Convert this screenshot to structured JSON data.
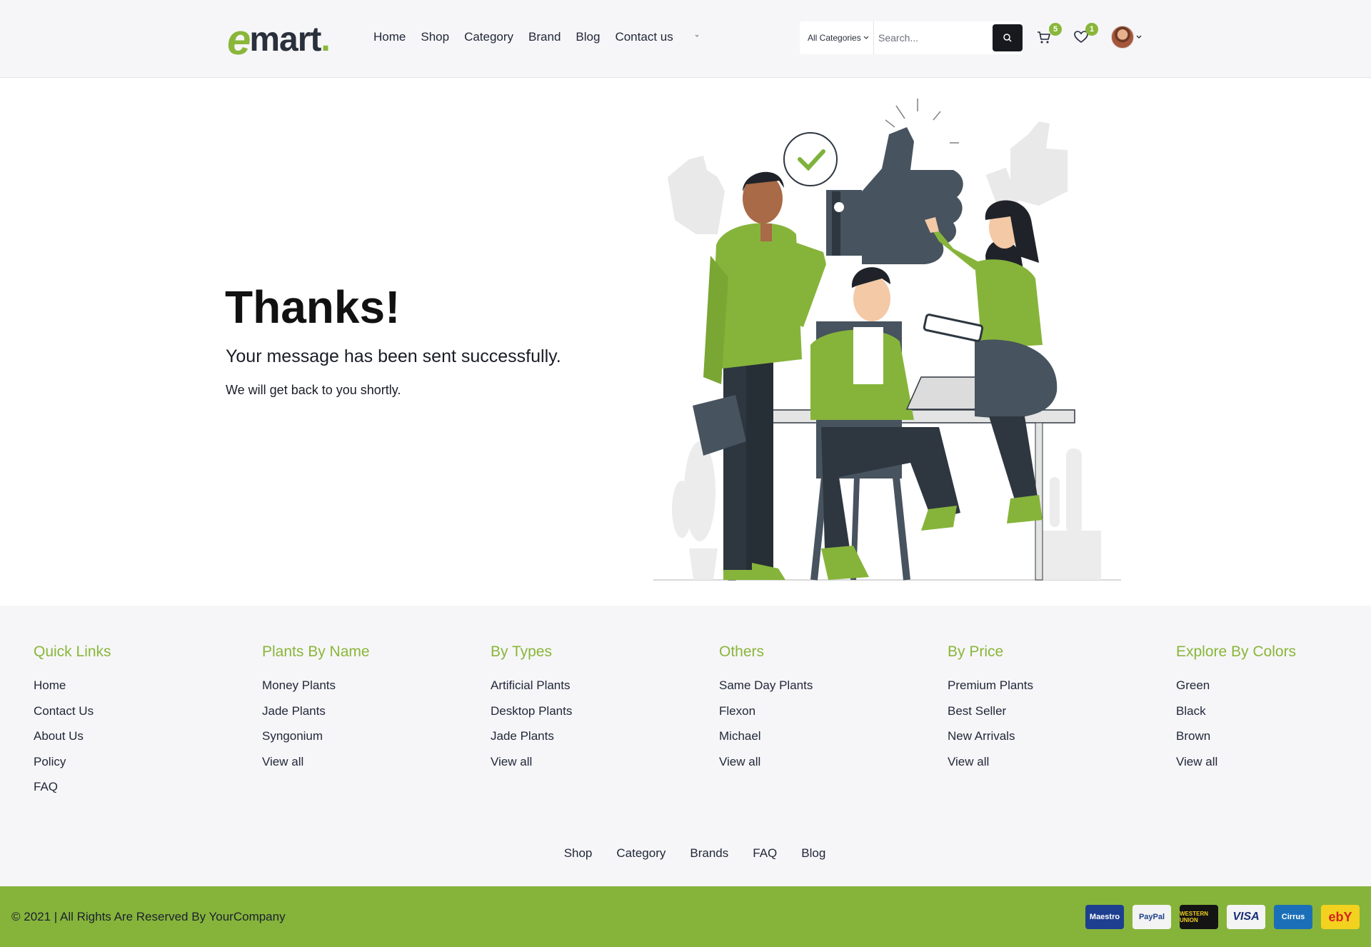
{
  "header": {
    "logo": {
      "e": "e",
      "rest": "mart",
      "dot": "."
    },
    "nav": [
      "Home",
      "Shop",
      "Category",
      "Brand",
      "Blog",
      "Contact us"
    ],
    "search": {
      "category": "All Categories",
      "placeholder": "Search..."
    },
    "cart_count": "5",
    "wishlist_count": "1"
  },
  "hero": {
    "title": "Thanks!",
    "subtitle": "Your message has been sent successfully.",
    "note": "We will get back to you shortly."
  },
  "footer": {
    "columns": [
      {
        "title": "Quick Links",
        "links": [
          "Home",
          "Contact Us",
          "About Us",
          "Policy",
          "FAQ"
        ]
      },
      {
        "title": "Plants By Name",
        "links": [
          "Money Plants",
          "Jade Plants",
          "Syngonium",
          "View all"
        ]
      },
      {
        "title": "By Types",
        "links": [
          "Artificial Plants",
          "Desktop Plants",
          "Jade Plants",
          "View all"
        ]
      },
      {
        "title": "Others",
        "links": [
          "Same Day Plants",
          "Flexon",
          "Michael",
          "View all"
        ]
      },
      {
        "title": "By Price",
        "links": [
          "Premium Plants",
          "Best Seller",
          "New Arrivals",
          "View all"
        ]
      },
      {
        "title": "Explore By Colors",
        "links": [
          "Green",
          "Black",
          "Brown",
          "View all"
        ]
      }
    ],
    "bottom_links": [
      "Shop",
      "Category",
      "Brands",
      "FAQ",
      "Blog"
    ],
    "copyright": "© 2021 | All Rights Are Reserved By YourCompany",
    "payments": [
      {
        "name": "maestro-icon",
        "label": "Maestro",
        "bg": "#1e3f8f",
        "fg": "#ffffff"
      },
      {
        "name": "paypal-icon",
        "label": "PayPal",
        "bg": "#f3f3f3",
        "fg": "#1d3f8a"
      },
      {
        "name": "western-union-icon",
        "label": "WESTERN UNION",
        "bg": "#141414",
        "fg": "#f3d11f"
      },
      {
        "name": "visa-icon",
        "label": "VISA",
        "bg": "#f4f4f4",
        "fg": "#1a2e7a"
      },
      {
        "name": "cirrus-icon",
        "label": "Cirrus",
        "bg": "#1b6fb8",
        "fg": "#ffffff"
      },
      {
        "name": "ebay-icon",
        "label": "ebY",
        "bg": "#f3d11f",
        "fg": "#d3241d"
      }
    ]
  },
  "colors": {
    "brand_green": "#8ab63a",
    "bar_green": "#86b43a",
    "dark": "#17191f"
  }
}
